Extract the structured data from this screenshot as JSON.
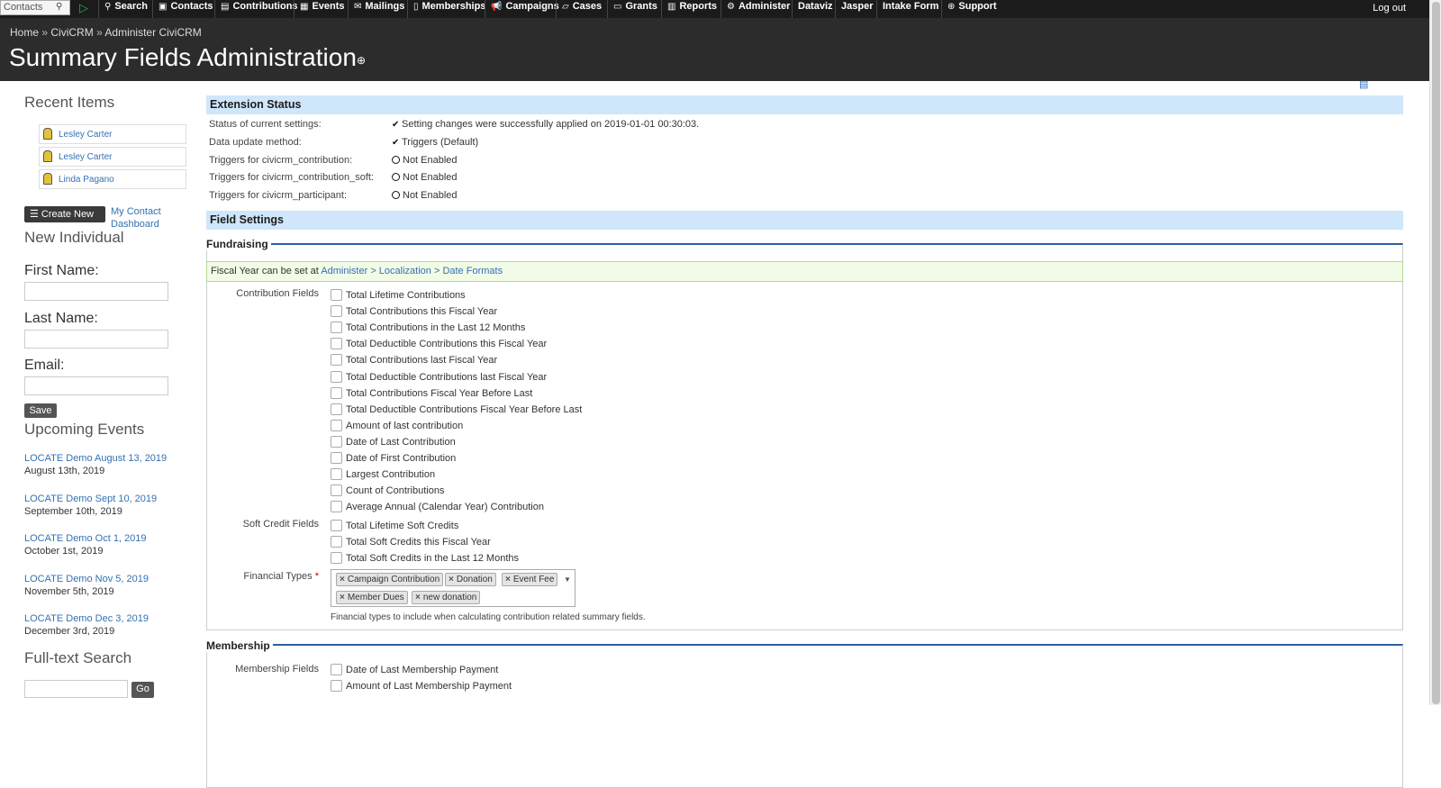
{
  "topbar": {
    "quicksearch_placeholder": "Contacts",
    "items": [
      {
        "icon": "search-icon",
        "glyph": "⚲",
        "label": "Search"
      },
      {
        "icon": "contacts-icon",
        "glyph": "▣",
        "label": "Contacts"
      },
      {
        "icon": "contributions-icon",
        "glyph": "▤",
        "label": "Contributions"
      },
      {
        "icon": "events-icon",
        "glyph": "▦",
        "label": "Events"
      },
      {
        "icon": "mailings-icon",
        "glyph": "✉",
        "label": "Mailings"
      },
      {
        "icon": "memberships-icon",
        "glyph": "▯",
        "label": "Memberships"
      },
      {
        "icon": "campaigns-icon",
        "glyph": "📢",
        "label": "Campaigns"
      },
      {
        "icon": "cases-icon",
        "glyph": "▱",
        "label": "Cases"
      },
      {
        "icon": "grants-icon",
        "glyph": "▭",
        "label": "Grants"
      },
      {
        "icon": "reports-icon",
        "glyph": "▥",
        "label": "Reports"
      },
      {
        "icon": "administer-icon",
        "glyph": "⚙",
        "label": "Administer"
      },
      {
        "icon": "",
        "glyph": "",
        "label": "Dataviz"
      },
      {
        "icon": "",
        "glyph": "",
        "label": "Jasper"
      },
      {
        "icon": "",
        "glyph": "",
        "label": "Intake Form"
      },
      {
        "icon": "support-icon",
        "glyph": "⊕",
        "label": "Support"
      }
    ],
    "logout": "Log out"
  },
  "header": {
    "breadcrumb": [
      "Home",
      "CiviCRM",
      "Administer CiviCRM"
    ],
    "breadcrumb_sep": "»",
    "title": "Summary Fields Administration"
  },
  "sidebar": {
    "recent_heading": "Recent Items",
    "recent": [
      "Lesley Carter",
      "Lesley Carter",
      "Linda Pagano"
    ],
    "create_new": "Create New",
    "my_dashboard": "My Contact Dashboard",
    "new_individual": "New Individual",
    "first_name": "First Name:",
    "last_name": "Last Name:",
    "email": "Email:",
    "save": "Save",
    "upcoming_heading": "Upcoming Events",
    "events": [
      {
        "title": "LOCATE Demo August 13, 2019",
        "date": "August 13th, 2019"
      },
      {
        "title": "LOCATE Demo Sept 10, 2019",
        "date": "September 10th, 2019"
      },
      {
        "title": "LOCATE Demo Oct 1, 2019",
        "date": "October 1st, 2019"
      },
      {
        "title": "LOCATE Demo Nov 5, 2019",
        "date": "November 5th, 2019"
      },
      {
        "title": "LOCATE Demo Dec 3, 2019",
        "date": "December 3rd, 2019"
      }
    ],
    "fulltext_heading": "Full-text Search",
    "go": "Go"
  },
  "extension_status": {
    "heading": "Extension Status",
    "rows": [
      {
        "label": "Status of current settings:",
        "value": "Setting changes were successfully applied on 2019-01-01 00:30:03.",
        "state": "check"
      },
      {
        "label": "Data update method:",
        "value": "Triggers (Default)",
        "state": "check"
      },
      {
        "label": "Triggers for civicrm_contribution:",
        "value": "Not Enabled",
        "state": "ring"
      },
      {
        "label": "Triggers for civicrm_contribution_soft:",
        "value": "Not Enabled",
        "state": "ring"
      },
      {
        "label": "Triggers for civicrm_participant:",
        "value": "Not Enabled",
        "state": "ring"
      }
    ]
  },
  "field_settings": {
    "heading": "Field Settings",
    "fundraising_legend": "Fundraising",
    "fy_note": "Fiscal Year can be set at",
    "fy_link": "Administer > Localization > Date Formats",
    "contribution_label": "Contribution Fields",
    "contribution_fields": [
      "Total Lifetime Contributions",
      "Total Contributions this Fiscal Year",
      "Total Contributions in the Last 12 Months",
      "Total Deductible Contributions this Fiscal Year",
      "Total Contributions last Fiscal Year",
      "Total Deductible Contributions last Fiscal Year",
      "Total Contributions Fiscal Year Before Last",
      "Total Deductible Contributions Fiscal Year Before Last",
      "Amount of last contribution",
      "Date of Last Contribution",
      "Date of First Contribution",
      "Largest Contribution",
      "Count of Contributions",
      "Average Annual (Calendar Year) Contribution"
    ],
    "soft_label": "Soft Credit Fields",
    "soft_fields": [
      "Total Lifetime Soft Credits",
      "Total Soft Credits this Fiscal Year",
      "Total Soft Credits in the Last 12 Months"
    ],
    "financial_label": "Financial Types",
    "financial_required": "*",
    "financial_types": [
      "Campaign Contribution",
      "Donation",
      "Event Fee",
      "Member Dues",
      "new donation"
    ],
    "financial_help": "Financial types to include when calculating contribution related summary fields.",
    "membership_legend": "Membership",
    "membership_label": "Membership Fields",
    "membership_fields": [
      "Date of Last Membership Payment",
      "Amount of Last Membership Payment"
    ]
  }
}
